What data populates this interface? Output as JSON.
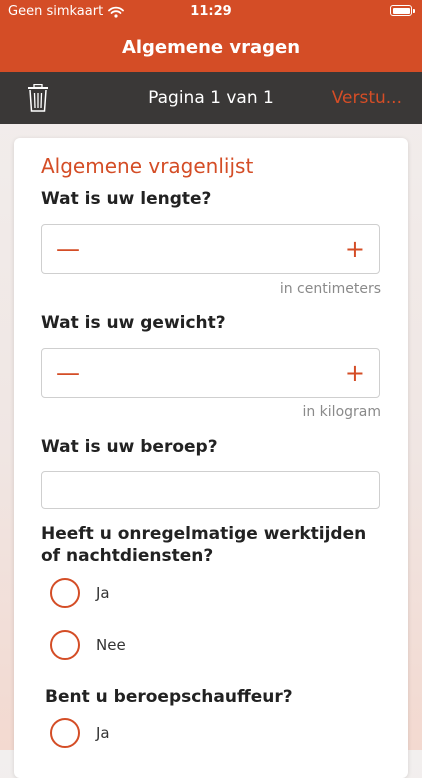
{
  "status_bar": {
    "carrier": "Geen simkaart",
    "time": "11:29"
  },
  "header": {
    "title": "Algemene vragen"
  },
  "toolbar": {
    "page_indicator": "Pagina 1 van 1",
    "send_label": "Verstu..."
  },
  "form": {
    "title": "Algemene vragenlijst",
    "questions": [
      {
        "label": "Wat is uw lengte?",
        "unit": "in centimeters",
        "minus": "—",
        "plus": "+"
      },
      {
        "label": "Wat is uw gewicht?",
        "unit": "in kilogram",
        "minus": "—",
        "plus": "+"
      },
      {
        "label": "Wat is uw beroep?",
        "value": ""
      },
      {
        "label": "Heeft u onregelmatige werktijden of nachtdiensten?",
        "options": [
          "Ja",
          "Nee"
        ]
      },
      {
        "label": "Bent u beroepschauffeur?",
        "options": [
          "Ja"
        ]
      }
    ]
  },
  "colors": {
    "accent": "#d44d26",
    "toolbar": "#3a3837",
    "text": "#222222",
    "muted": "#8a8a8a"
  }
}
